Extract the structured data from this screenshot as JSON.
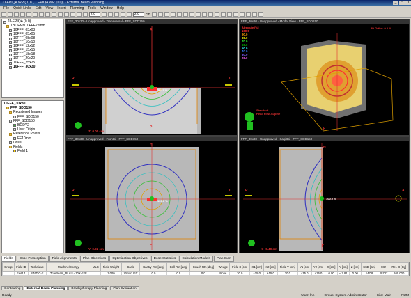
{
  "window": {
    "title": "JJ-EPIQA WP (0.0) [... EPIQA WP (0.0)] - External Beam Planning"
  },
  "menu": [
    "File",
    "Quick Links",
    "Edit",
    "View",
    "Insert",
    "Planning",
    "Tools",
    "Window",
    "Help"
  ],
  "toolbar": {
    "zoom_value": "2.0",
    "slice_value": "2.0",
    "unit": "cm"
  },
  "tree_top": {
    "root": "JJ-EPIQA (0.0)",
    "course": "TBOFMN10FFF22mm",
    "plans": [
      "10FFF_03x03",
      "10FFF_05x05",
      "10FFF_08x08",
      "10FFF_10x10",
      "10FFF_12x12",
      "10FFF_15x15",
      "10FFF_18x18",
      "10FFF_20x20",
      "10FFF_25x25",
      "10FFF_30x30"
    ]
  },
  "tree_bottom": {
    "plan": "10FFF_30x30",
    "image": "FFF_SDD150",
    "registered": "Registered Images",
    "sub_image": "FFF_SDD150",
    "items": [
      "FFF_SDD150",
      "BODY2",
      "User Origin",
      "Reference Points",
      "FF10mm",
      "Dose",
      "Fields",
      "Field 1"
    ]
  },
  "viewports": {
    "transversal": {
      "title": "FFF_30x30 - Unapproved - Transversal - FFF_SDD150",
      "labels": {
        "top": "A",
        "left": "R",
        "right": "L",
        "bottom": "P"
      },
      "iso": "100.0 %",
      "coord": "Z: 0.00 cm"
    },
    "model": {
      "title": "FFF_30x30 - Unapproved - Model View - FFF_SDD150",
      "top_right": "3D Ortho: 0.0 %",
      "legend_title": "Absolute [%]",
      "legend": [
        "100.0",
        "90.0",
        "80.0",
        "70.0",
        "60.0",
        "50.0",
        "40.0",
        "30.0",
        "20.0"
      ],
      "legend_colors": [
        "#ff3030",
        "#ffa000",
        "#ffff00",
        "#30ff30",
        "#00c000",
        "#30ffff",
        "#3080ff",
        "#8060ff",
        "#ff60ff"
      ],
      "setup": "Standard",
      "setup2": "Head First-Supine",
      "orient": "F"
    },
    "frontal": {
      "title": "FFF_30x30 - Unapproved - Frontal - FFF_SDD150",
      "labels": {
        "top": "H",
        "left": "R",
        "right": "L",
        "bottom": "F"
      },
      "iso": "100.0 %",
      "coord": "Y: 0.22 cm"
    },
    "sagittal": {
      "title": "FFF_30x30 - Unapproved - Sagittal - FFF_SDD150",
      "labels": {
        "top": "H",
        "left": "P",
        "right": "A",
        "bottom": "F"
      },
      "iso": "100.0 %",
      "coord": "X: -0.48 cm"
    }
  },
  "detail_tabs": [
    "Fields",
    "Dose Prescription",
    "Field Alignments",
    "Plan Objectives",
    "Optimization Objectives",
    "Dose Statistics",
    "Calculation Models",
    "Plan Sum"
  ],
  "fields_table": {
    "headers": [
      "Group",
      "Field ID",
      "Technique",
      "Machine/Energy",
      "MLC",
      "Field Weight",
      "Scale",
      "Gantry Rtn [deg]",
      "Coll Rtn [deg]",
      "Couch Rtn [deg]",
      "Wedge",
      "Field X [cm]",
      "X1 [cm]",
      "X2 [cm]",
      "Field Y [cm]",
      "Y1 [cm]",
      "Y2 [cm]",
      "X [cm]",
      "Y [cm]",
      "Z [cm]",
      "SSD [cm]",
      "MU",
      "Ref. D [Gy]"
    ],
    "rows": [
      [
        "",
        "Field 1",
        "STATIC-F",
        "TrueBeam_BLAU - 10X-FFF",
        "",
        "1.000",
        "Varian IEC",
        "0.0",
        "0.0",
        "0.0",
        "None",
        "30.0",
        "+15.0",
        "+15.0",
        "30.0",
        "+15.0",
        "+15.0",
        "0.00",
        "-47.81",
        "0.00",
        "147.8",
        "29737",
        "100.000"
      ]
    ]
  },
  "workspace_tabs": [
    "Contouring",
    "External Beam Planning",
    "Brachytherapy Planning",
    "Plan Evaluation"
  ],
  "status": {
    "left": "Ready",
    "user": "User: lnh",
    "group": "Group: System Administrator",
    "site": "Site: Main",
    "mode": "NUM"
  }
}
